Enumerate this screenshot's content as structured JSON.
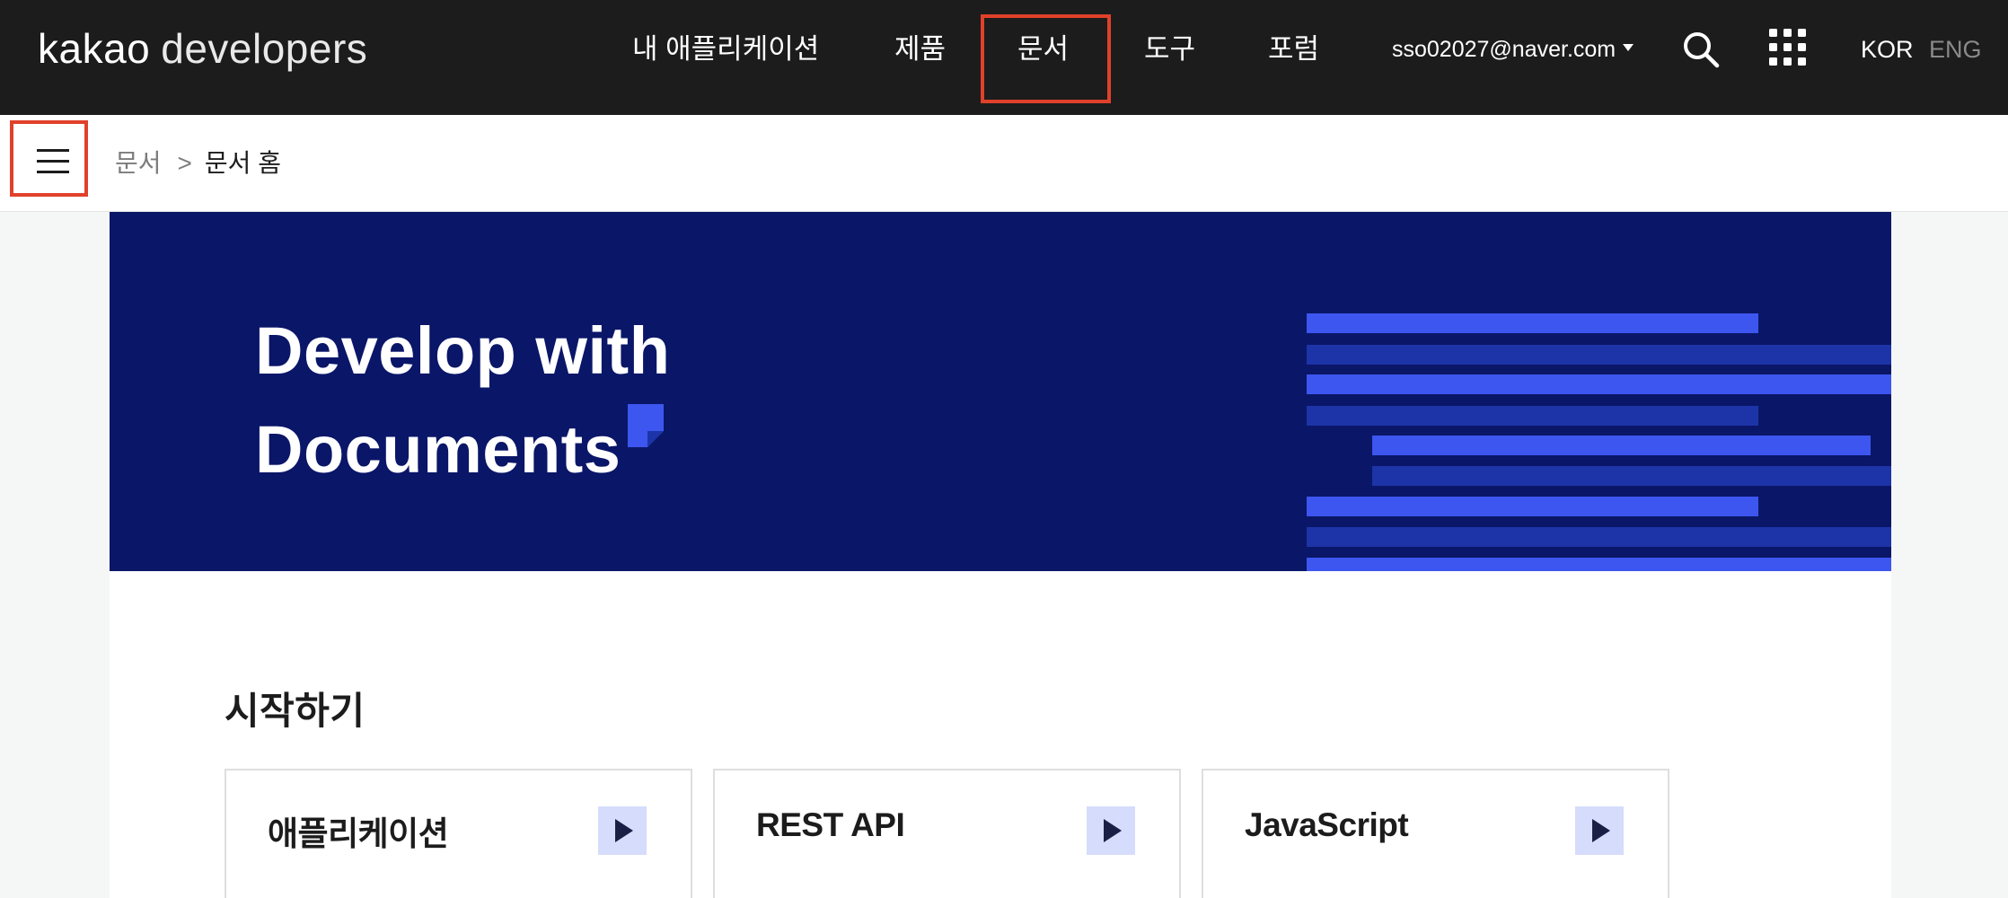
{
  "header": {
    "logo_kakao": "kakao",
    "logo_developers": "developers",
    "nav": {
      "my_apps": "내 애플리케이션",
      "products": "제품",
      "docs": "문서",
      "tools": "도구",
      "forum": "포럼"
    },
    "user_email": "sso02027@naver.com",
    "lang_kor": "KOR",
    "lang_eng": "ENG",
    "icons": [
      "search-icon",
      "apps-grid-icon",
      "caret-down-icon"
    ]
  },
  "breadcrumb": {
    "root": "문서",
    "separator": ">",
    "current": "문서 홈"
  },
  "hero": {
    "line1": "Develop with",
    "line2": "Documents",
    "background_color": "#0a1668",
    "accent_color": "#3d56f0"
  },
  "getting_started": {
    "title": "시작하기",
    "cards": [
      {
        "label": "애플리케이션"
      },
      {
        "label": "REST API"
      },
      {
        "label": "JavaScript"
      }
    ]
  },
  "colors": {
    "topbar": "#1c1c1c",
    "highlight_box": "#e0412b",
    "card_arrow_bg": "#d6dcfb"
  }
}
